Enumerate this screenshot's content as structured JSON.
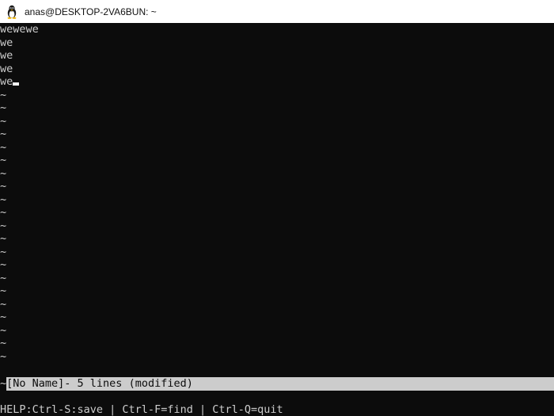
{
  "window": {
    "title": "anas@DESKTOP-2VA6BUN: ~",
    "icon": "linux-tux-icon"
  },
  "editor": {
    "lines": [
      "wewewe",
      "we",
      "we",
      "we",
      "we"
    ],
    "empty_line_marker": "~",
    "status_bar": "[No Name]- 5 lines (modified)",
    "help_text": "HELP:Ctrl-S:save | Ctrl-F=find | Ctrl-Q=quit"
  },
  "colors": {
    "terminal_background": "#0c0c0c",
    "terminal_foreground": "#cccccc",
    "status_bar_background": "#cccccc",
    "titlebar_background": "#ffffff"
  }
}
